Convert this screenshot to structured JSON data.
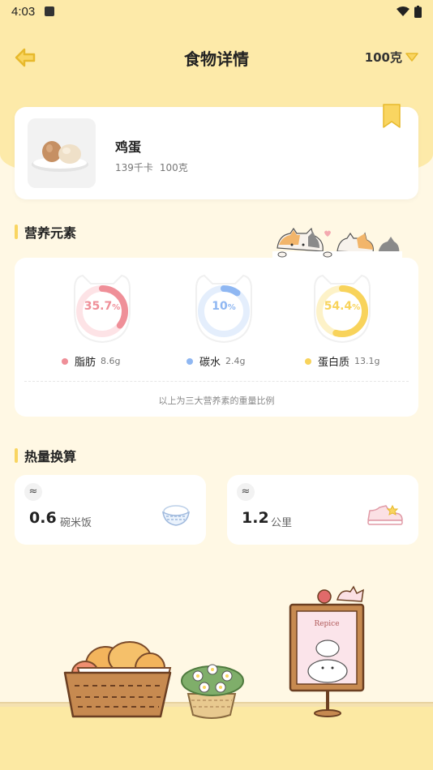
{
  "status_bar": {
    "time": "4:03"
  },
  "header": {
    "title": "食物详情",
    "weight": "100克"
  },
  "food": {
    "name": "鸡蛋",
    "calories": "139千卡",
    "weight": "100克"
  },
  "nutrition": {
    "section_title": "营养元素",
    "items": [
      {
        "percent": "35.7",
        "percent_unit": "%",
        "fraction": 0.357,
        "name": "脂肪",
        "amount": "8.6g",
        "color": "#ef8f98",
        "track": "#fde3e6"
      },
      {
        "percent": "10",
        "percent_unit": "%",
        "fraction": 0.1,
        "name": "碳水",
        "amount": "2.4g",
        "color": "#8fb7f2",
        "track": "#e4eefc"
      },
      {
        "percent": "54.4",
        "percent_unit": "%",
        "fraction": 0.544,
        "name": "蛋白质",
        "amount": "13.1g",
        "color": "#f8d35b",
        "track": "#fdf2c8"
      }
    ],
    "note": "以上为三大营养素的重量比例"
  },
  "conversion": {
    "section_title": "热量换算",
    "approx_symbol": "≈",
    "items": [
      {
        "value": "0.6",
        "unit": "碗米饭",
        "icon": "rice-bowl-icon"
      },
      {
        "value": "1.2",
        "unit": "公里",
        "icon": "sneaker-icon"
      }
    ]
  },
  "scene": {
    "sign_text": "Repice"
  },
  "colors": {
    "accent": "#f9d561",
    "background": "#fff8e4",
    "header_bg": "#fdeaa9"
  }
}
